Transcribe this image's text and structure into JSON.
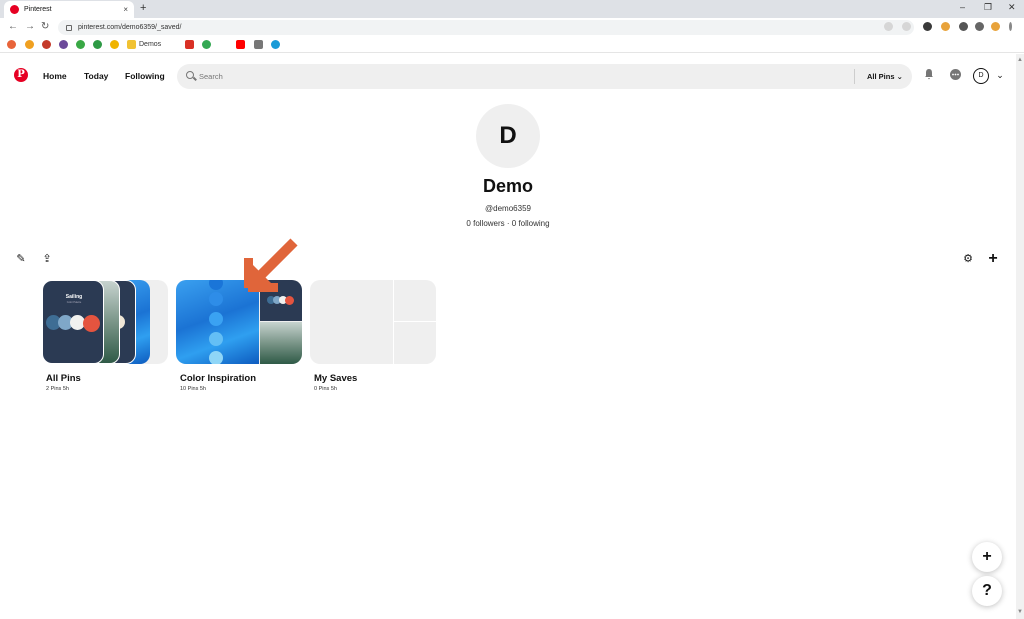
{
  "browser": {
    "tab_title": "Pinterest",
    "tab_close": "×",
    "new_tab": "+",
    "url": "pinterest.com/demo6359/_saved/",
    "bookmark_label": "Demos",
    "win_min": "–",
    "win_max": "❐",
    "win_close": "✕",
    "back": "←",
    "forward": "→",
    "reload": "↻"
  },
  "header": {
    "logo": "P",
    "nav": [
      "Home",
      "Today",
      "Following"
    ],
    "search_placeholder": "Search",
    "filter_label": "All Pins ⌄",
    "avatar_initial": "D",
    "bell": "🔔",
    "chat": "💬",
    "chevron": "⌄"
  },
  "profile": {
    "initial": "D",
    "name": "Demo",
    "handle": "@demo6359",
    "follow_stats": "0 followers · 0 following"
  },
  "toolbar": {
    "edit": "✎",
    "share": "⇪",
    "filter": "⚙",
    "add": "+"
  },
  "boards": [
    {
      "title": "All Pins",
      "meta": "2 Pins   5h",
      "cover_title": "Sailing",
      "cover_sub": "Color Palette"
    },
    {
      "title": "Color Inspiration",
      "meta": "10 Pins   5h"
    },
    {
      "title": "My Saves",
      "meta": "0 Pins   5h"
    }
  ],
  "fab": {
    "add": "+",
    "help": "?"
  },
  "colors": {
    "brand": "#e60023",
    "arrow": "#e0653a",
    "navy": "#2b3a53",
    "swatch_blue": "#3e6d94",
    "swatch_light": "#7fa7c8",
    "swatch_white": "#f1f1ef",
    "swatch_red": "#e4543f",
    "dot_colors": [
      "#1a75d8",
      "#2e8de8",
      "#3aa2f2",
      "#64bff5",
      "#8fd6f7"
    ]
  }
}
